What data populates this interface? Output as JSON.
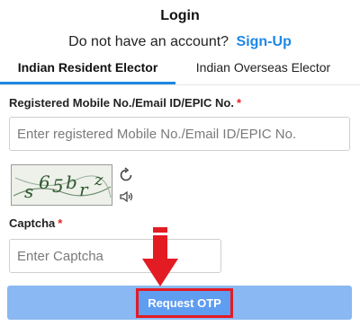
{
  "header": {
    "title": "Login",
    "signup_prompt": "Do not have an account?",
    "signup_link": "Sign-Up"
  },
  "tabs": [
    {
      "label": "Indian Resident Elector",
      "active": true
    },
    {
      "label": "Indian Overseas Elector",
      "active": false
    }
  ],
  "form": {
    "mobile_label": "Registered Mobile No./Email ID/EPIC No.",
    "mobile_required": "*",
    "mobile_placeholder": "Enter registered Mobile No./Email ID/EPIC No.",
    "mobile_value": "",
    "captcha_image_text": "s65brz",
    "captcha_label": "Captcha",
    "captcha_required": "*",
    "captcha_placeholder": "Enter Captcha",
    "captcha_value": "",
    "submit_label": "Request OTP"
  },
  "icons": {
    "refresh": "refresh-icon",
    "audio": "speaker-icon",
    "arrow": "arrow-down-icon"
  },
  "colors": {
    "accent": "#1e88e5",
    "required": "#e02424",
    "button_bg": "#5f9df0",
    "highlight": "#e31b23"
  }
}
